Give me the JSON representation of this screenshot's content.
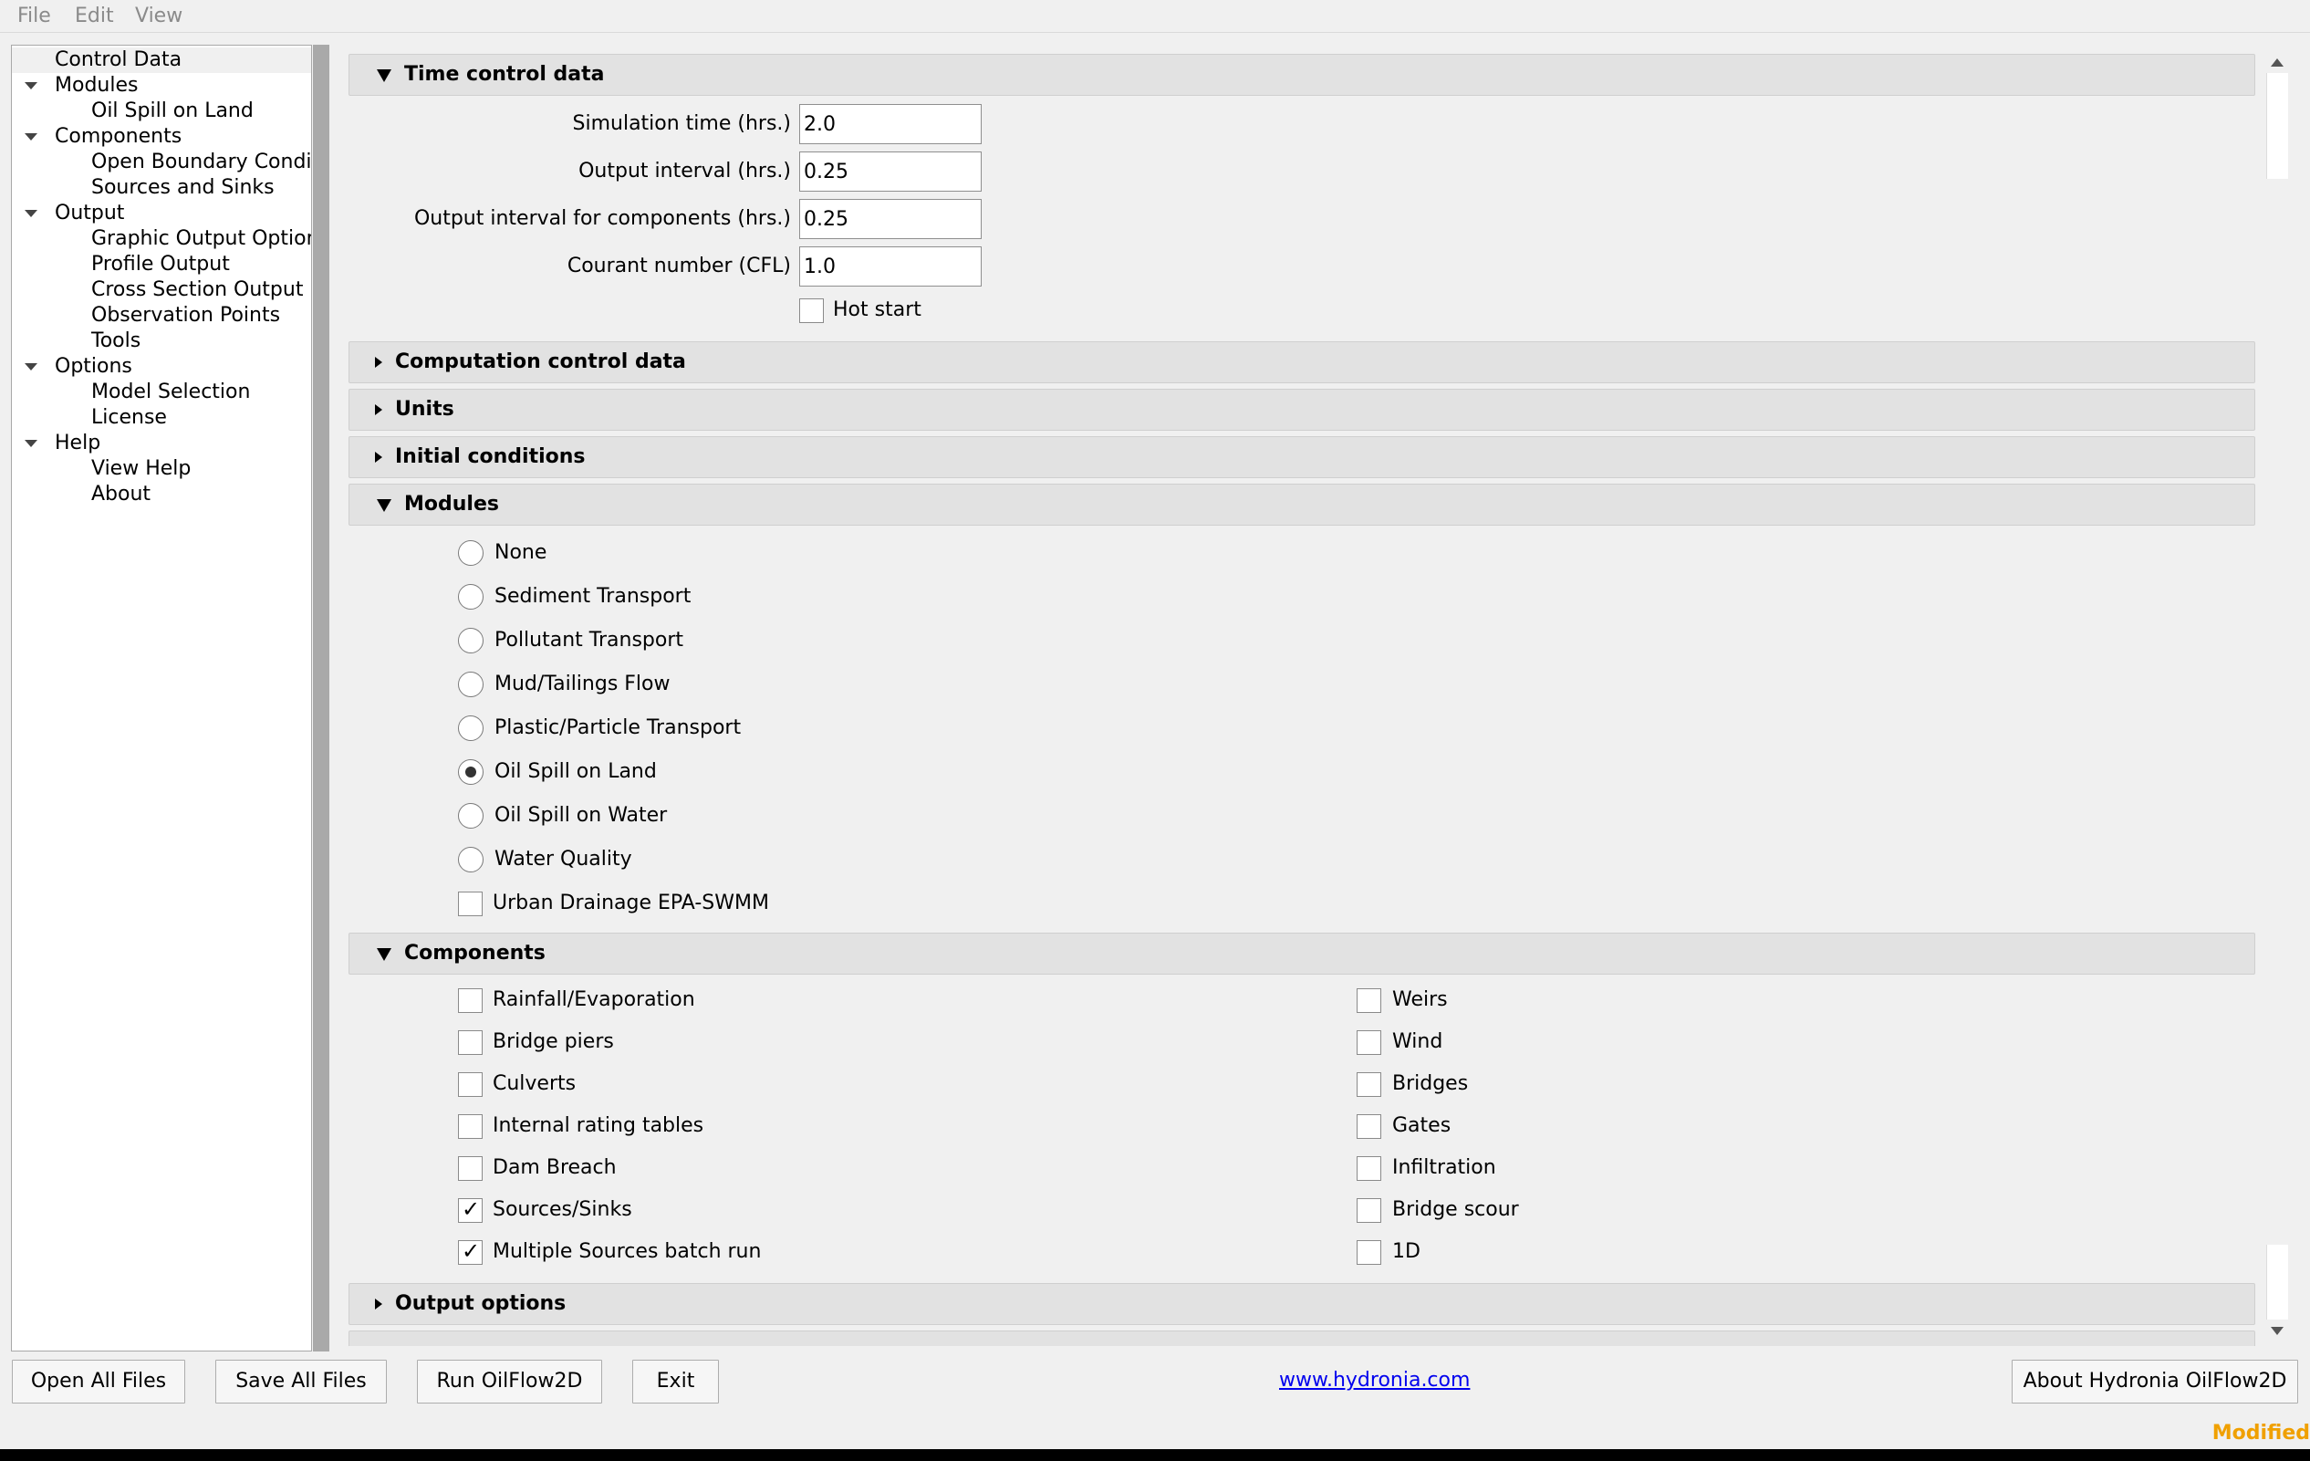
{
  "menubar": {
    "items": [
      "File",
      "Edit",
      "View"
    ]
  },
  "nav": {
    "items": [
      {
        "label": "Control Data",
        "level": 0,
        "expandable": false,
        "selected": true
      },
      {
        "label": "Modules",
        "level": 0,
        "expandable": true
      },
      {
        "label": "Oil Spill on Land",
        "level": 1
      },
      {
        "label": "Components",
        "level": 0,
        "expandable": true
      },
      {
        "label": "Open Boundary Condi...",
        "level": 1
      },
      {
        "label": "Sources and Sinks",
        "level": 1
      },
      {
        "label": "Output",
        "level": 0,
        "expandable": true
      },
      {
        "label": "Graphic Output Options",
        "level": 1
      },
      {
        "label": "Profile Output",
        "level": 1
      },
      {
        "label": "Cross Section Output",
        "level": 1
      },
      {
        "label": "Observation Points",
        "level": 1
      },
      {
        "label": "Tools",
        "level": 1
      },
      {
        "label": "Options",
        "level": 0,
        "expandable": true
      },
      {
        "label": "Model Selection",
        "level": 1
      },
      {
        "label": "License",
        "level": 1
      },
      {
        "label": "Help",
        "level": 0,
        "expandable": true
      },
      {
        "label": "View Help",
        "level": 1
      },
      {
        "label": "About",
        "level": 1
      }
    ]
  },
  "time_control": {
    "title": "Time control data",
    "fields": [
      {
        "label": "Simulation time (hrs.)",
        "value": "2.0"
      },
      {
        "label": "Output interval (hrs.)",
        "value": "0.25"
      },
      {
        "label": "Output interval for components (hrs.)",
        "value": "0.25"
      },
      {
        "label": "Courant number (CFL)",
        "value": "1.0"
      }
    ],
    "hot_start": {
      "label": "Hot start",
      "checked": false
    }
  },
  "sections": {
    "computation": "Computation control data",
    "units": "Units",
    "initial": "Initial conditions",
    "modules": "Modules",
    "components": "Components",
    "output": "Output options"
  },
  "modules": {
    "options": [
      {
        "label": "None",
        "selected": false
      },
      {
        "label": "Sediment Transport",
        "selected": false
      },
      {
        "label": "Pollutant Transport",
        "selected": false
      },
      {
        "label": "Mud/Tailings Flow",
        "selected": false
      },
      {
        "label": "Plastic/Particle Transport",
        "selected": false
      },
      {
        "label": "Oil Spill on Land",
        "selected": true
      },
      {
        "label": "Oil Spill on Water",
        "selected": false
      },
      {
        "label": "Water Quality",
        "selected": false
      }
    ],
    "urban_drainage": {
      "label": "Urban Drainage EPA-SWMM",
      "checked": false
    }
  },
  "components": {
    "left": [
      {
        "label": "Rainfall/Evaporation",
        "checked": false
      },
      {
        "label": "Bridge piers",
        "checked": false
      },
      {
        "label": "Culverts",
        "checked": false
      },
      {
        "label": "Internal rating tables",
        "checked": false
      },
      {
        "label": "Dam Breach",
        "checked": false
      },
      {
        "label": "Sources/Sinks",
        "checked": true
      },
      {
        "label": "Multiple Sources batch run",
        "checked": true
      }
    ],
    "right": [
      {
        "label": "Weirs",
        "checked": false
      },
      {
        "label": "Wind",
        "checked": false
      },
      {
        "label": "Bridges",
        "checked": false
      },
      {
        "label": "Gates",
        "checked": false
      },
      {
        "label": "Infiltration",
        "checked": false
      },
      {
        "label": "Bridge scour",
        "checked": false
      },
      {
        "label": "1D",
        "checked": false
      }
    ]
  },
  "bottom": {
    "open_all": "Open All Files",
    "save_all": "Save All Files",
    "run": "Run OilFlow2D",
    "exit": "Exit",
    "link": "www.hydronia.com",
    "about": "About Hydronia OilFlow2D",
    "status": "Modified",
    "status_color": "#f0a000",
    "link_color": "#0000ee"
  }
}
